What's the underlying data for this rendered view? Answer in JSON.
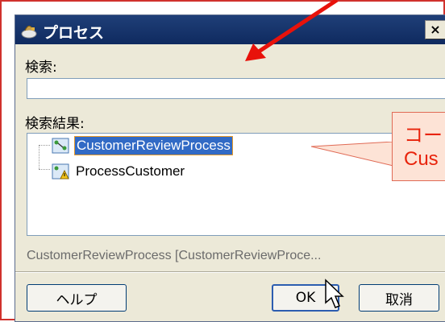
{
  "dialog": {
    "title": "プロセス",
    "close_label": "×",
    "search": {
      "label": "検索:",
      "value": "",
      "placeholder": ""
    },
    "results": {
      "label": "検索結果:",
      "items": [
        {
          "label": "CustomerReviewProcess",
          "selected": true,
          "icon": "process-icon"
        },
        {
          "label": "ProcessCustomer",
          "selected": false,
          "icon": "process-warning-icon"
        }
      ]
    },
    "status_text": "CustomerReviewProcess [CustomerReviewProce...",
    "buttons": {
      "help": "ヘルプ",
      "ok": "OK",
      "cancel": "取消"
    }
  },
  "annotation": {
    "callout_line1": "コー",
    "callout_line2": "Cus",
    "callout_color": "#e8230b",
    "arrow_color": "#e8120b"
  },
  "colors": {
    "titlebar": "#0f2a5f",
    "selection": "#316ac5",
    "frame": "#d0312d"
  }
}
